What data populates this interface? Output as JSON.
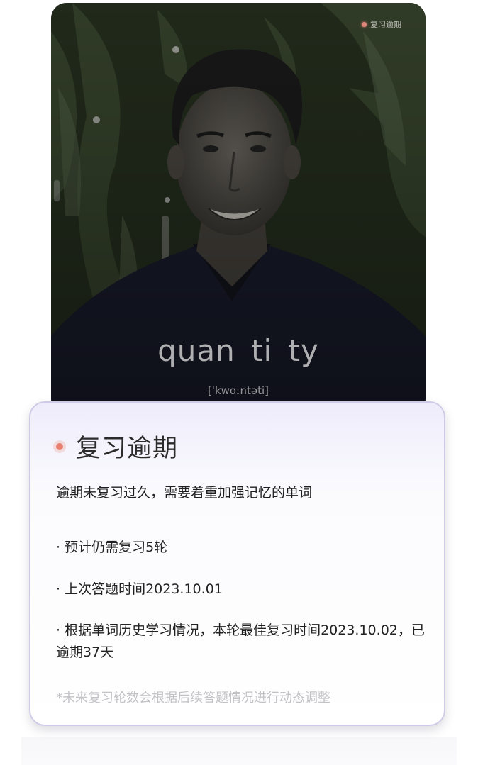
{
  "badge": {
    "label": "复习逾期",
    "icon": "red-dot-icon",
    "color": "#e0857a"
  },
  "flashcard": {
    "word": "quan ti ty",
    "phonetic": "[ˈkwɑːntəti]"
  },
  "status_card": {
    "title": "复习逾期",
    "title_icon": "red-dot-icon",
    "subtitle": "逾期未复习过久，需要着重加强记忆的单词",
    "bullets": [
      "· 预计仍需复习5轮",
      "· 上次答题时间2023.10.01",
      "· 根据单词历史学习情况，本轮最佳复习时间2023.10.02，已逾期37天"
    ],
    "footnote": "*未来复习轮数会根据后续答题情况进行动态调整"
  }
}
